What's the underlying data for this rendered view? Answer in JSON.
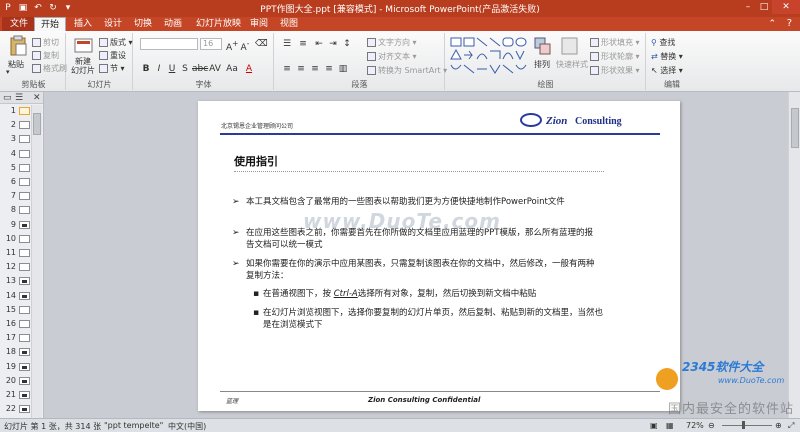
{
  "window": {
    "title": "PPT作图大全.ppt [兼容模式] - Microsoft PowerPoint(产品激活失败)"
  },
  "tabs": [
    "文件",
    "开始",
    "插入",
    "设计",
    "切换",
    "动画",
    "幻灯片放映",
    "审阅",
    "视图"
  ],
  "ribbon": {
    "clipboard": {
      "label": "剪贴板",
      "paste": "粘贴",
      "cut": "剪切",
      "copy": "复制",
      "format_painter": "格式刷"
    },
    "slides": {
      "label": "幻灯片",
      "new_slide": "新建\n幻灯片",
      "layout": "版式",
      "reset": "重设",
      "section": "节"
    },
    "font": {
      "label": "字体",
      "size": "16"
    },
    "paragraph": {
      "label": "段落",
      "text_direction": "文字方向",
      "align_text": "对齐文本",
      "convert_smartart": "转换为 SmartArt"
    },
    "drawing": {
      "label": "绘图",
      "arrange": "排列",
      "quick_styles": "快速样式",
      "shape_fill": "形状填充",
      "shape_outline": "形状轮廓",
      "shape_effects": "形状效果"
    },
    "editing": {
      "label": "编辑",
      "find": "查找",
      "replace": "替换",
      "select": "选择"
    }
  },
  "slide_pane": {
    "tabs": [
      "幻灯片",
      "大纲"
    ],
    "thumbnails": [
      "1",
      "2",
      "3",
      "4",
      "5",
      "6",
      "7",
      "8",
      "9",
      "10",
      "11",
      "12",
      "13",
      "14",
      "15",
      "16",
      "17",
      "18",
      "19",
      "20",
      "21",
      "22"
    ]
  },
  "slide": {
    "company": "北京锡恩企业管理顾问公司",
    "logo_zion": "Zion",
    "logo_consulting": "Consulting",
    "heading": "使用指引",
    "bullet1": "本工具文档包含了最常用的一些图表以帮助我们更为方便快捷地制作PowerPoint文件",
    "bullet2": "在应用这些图表之前，你需要首先在你所做的文档里应用蓝理的PPT模版，那么所有蓝理的报告文档可以统一模式",
    "bullet3": "如果你需要在你的演示中应用某图表，只需复制该图表在你的文档中，然后修改，一般有两种复制方法：",
    "sub1_prefix": "在普通视图下，按 ",
    "sub1_key": "Ctrl-A",
    "sub1_suffix": "选择所有对象，复制，然后切换到新文档中粘贴",
    "sub2": "在幻灯片浏览视图下，选择你要复制的幻灯片单页，然后复制、粘贴到新的文档里，当然也是在浏览模式下",
    "watermark": "www.DuoTe.com",
    "footer_left": "蓝理",
    "footer": "Zion Consulting Confidential"
  },
  "statusbar": {
    "slide_info": "幻灯片 第 1 张，共 314 张",
    "theme": "\"ppt tempelte\"",
    "language": "中文(中国)",
    "zoom": "72%"
  },
  "site_watermark": {
    "brand": "2345软件大全",
    "url": "www.DuoTe.com",
    "slogan": "国内最安全的软件站"
  }
}
